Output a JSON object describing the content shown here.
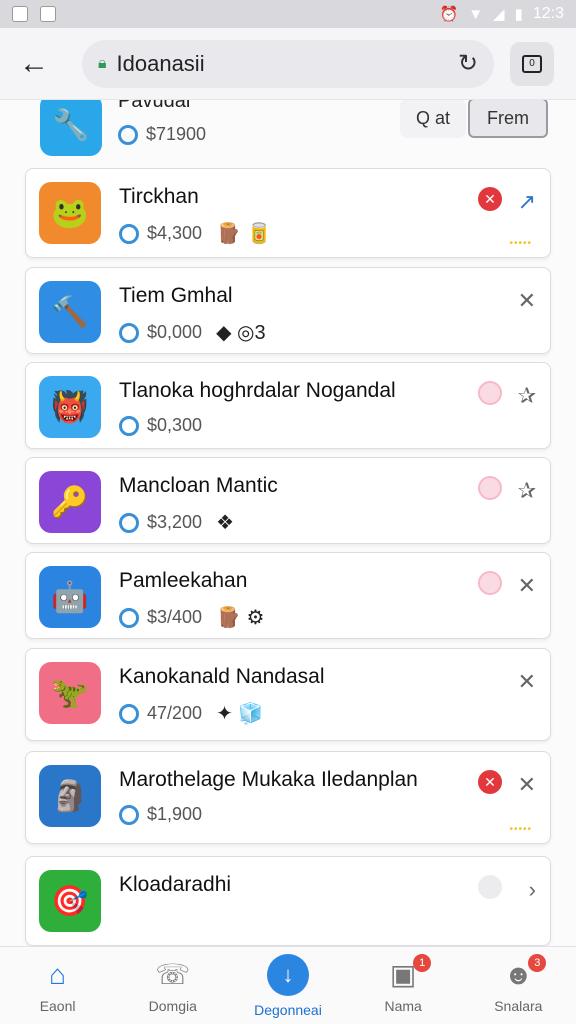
{
  "status_bar": {
    "time": "12:3"
  },
  "browser": {
    "url": "Idoanasii"
  },
  "top_row": {
    "title": "Pavudal",
    "price": "$71900",
    "search_label": "Q at",
    "filter_label": "Frem",
    "icon_color": "#2aa7e8"
  },
  "cards": [
    {
      "title": "Tirckhan",
      "price": "$4,300",
      "extra": "🪵 🥫",
      "icon": "🐸",
      "icon_color": "#f08a2c",
      "action": "red",
      "close": "↗",
      "dots": "•••••"
    },
    {
      "title": "Tiem Gmhal",
      "price": "$0,000",
      "extra": "◆ ◎3",
      "icon": "🔨",
      "icon_color": "#2f8de4",
      "action": "none",
      "close": "✕",
      "dots": ""
    },
    {
      "title": "Tlanoka hoghrdalar Nogandal",
      "price": "$0,300",
      "extra": "",
      "icon": "👹",
      "icon_color": "#3aa9ef",
      "action": "pink",
      "close": "✰",
      "dots": ""
    },
    {
      "title": "Mancloan Mantic",
      "price": "$3,200",
      "extra": "❖",
      "icon": "🔑",
      "icon_color": "#8a46d6",
      "action": "pink",
      "close": "✰",
      "dots": ""
    },
    {
      "title": "Pamleekahan",
      "price": "$3/400",
      "extra": "🪵 ⚙",
      "icon": "🤖",
      "icon_color": "#2a84e0",
      "action": "pink",
      "close": "✕",
      "dots": ""
    },
    {
      "title": "Kanokanald Nandasal",
      "price": "47/200",
      "extra": "✦ 🧊",
      "icon": "🦖",
      "icon_color": "#f06e86",
      "action": "none",
      "close": "✕",
      "dots": ""
    },
    {
      "title": "Marothelage Mukaka Iledanplan",
      "price": "$1,900",
      "extra": "",
      "icon": "🗿",
      "icon_color": "#2a76c8",
      "action": "red",
      "close": "✕",
      "dots": "•••••"
    },
    {
      "title": "Kloadaradhi",
      "price": "",
      "extra": "",
      "icon": "🎯",
      "icon_color": "#2eae3b",
      "action": "grey",
      "close": "›",
      "dots": ""
    }
  ],
  "nav": [
    {
      "label": "Eaonl",
      "icon": "home-icon",
      "glyph": "⌂",
      "badge": ""
    },
    {
      "label": "Domgia",
      "icon": "message-icon",
      "glyph": "☏",
      "badge": ""
    },
    {
      "label": "Degonneai",
      "icon": "download-icon",
      "glyph": "↓",
      "badge": ""
    },
    {
      "label": "Nama",
      "icon": "library-icon",
      "glyph": "▣",
      "badge": "1"
    },
    {
      "label": "Snalara",
      "icon": "profile-icon",
      "glyph": "☻",
      "badge": "3"
    }
  ]
}
